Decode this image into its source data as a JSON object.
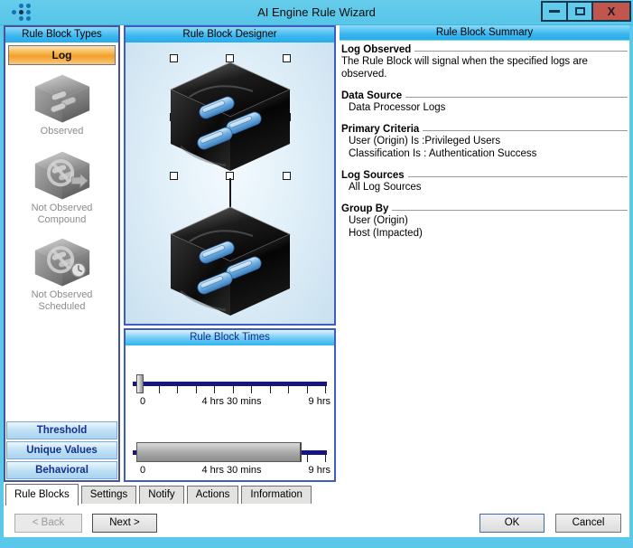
{
  "window": {
    "title": "AI Engine Rule Wizard"
  },
  "colors": {
    "titlebar": "#5BC8E9",
    "panel_header": "#30B3EF",
    "selected_type_orange": "#F6AC3E",
    "close_button_red": "#C0564C",
    "slider_track_navy": "#16167E",
    "category_text_navy": "#15308F"
  },
  "types_panel": {
    "header": "Rule Block Types",
    "selected": "Log",
    "items": [
      {
        "label": "Observed",
        "label2": ""
      },
      {
        "label": "Not Observed",
        "label2": "Compound"
      },
      {
        "label": "Not Observed",
        "label2": "Scheduled"
      }
    ],
    "buttons": [
      {
        "label": "Threshold"
      },
      {
        "label": "Unique Values"
      },
      {
        "label": "Behavioral"
      }
    ]
  },
  "designer": {
    "header": "Rule Block Designer"
  },
  "times": {
    "header": "Rule Block Times",
    "slider1": {
      "start": "0",
      "mid": "4 hrs 30 mins",
      "end": "9 hrs",
      "value_pct": 0
    },
    "slider2": {
      "start": "0",
      "mid": "4 hrs 30 mins",
      "end": "9 hrs",
      "range_start_pct": 0,
      "range_end_pct": 85
    }
  },
  "summary": {
    "header": "Rule Block Summary",
    "sections": [
      {
        "heading": "Log Observed",
        "line1": "The Rule Block will signal when the specified logs are observed."
      },
      {
        "heading": "Data Source",
        "line1": "Data Processor Logs"
      },
      {
        "heading": "Primary Criteria",
        "line1": "User (Origin) Is :Privileged Users",
        "line2": "Classification Is : Authentication Success"
      },
      {
        "heading": "Log Sources",
        "line1": "All Log Sources"
      },
      {
        "heading": "Group By",
        "line1": "User (Origin)",
        "line2": "Host (Impacted)"
      }
    ]
  },
  "tabs": [
    {
      "label": "Rule Blocks"
    },
    {
      "label": "Settings"
    },
    {
      "label": "Notify"
    },
    {
      "label": "Actions"
    },
    {
      "label": "Information"
    }
  ],
  "footer": {
    "back": "< Back",
    "next": "Next >",
    "ok": "OK",
    "cancel": "Cancel"
  }
}
